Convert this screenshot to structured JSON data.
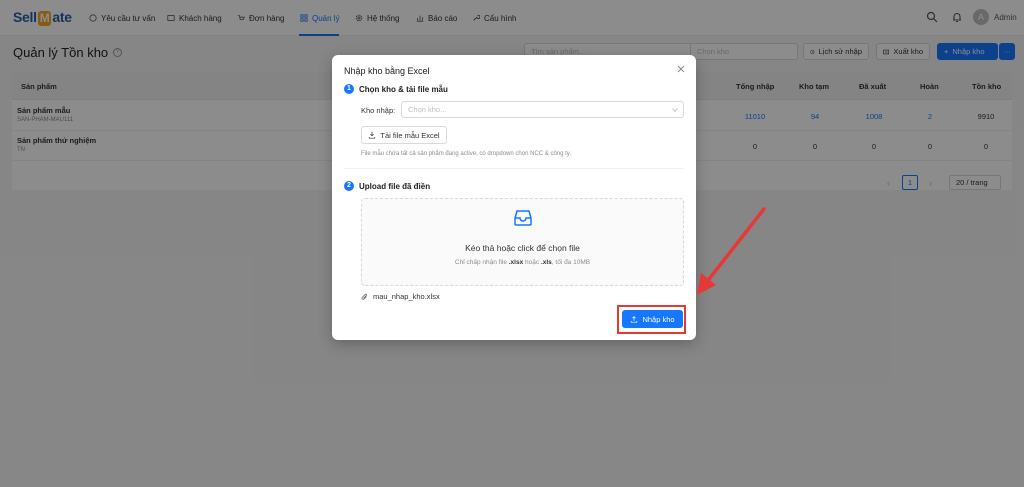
{
  "app": {
    "logo_prefix": "Sell",
    "logo_mark": "M",
    "logo_suffix": "ate",
    "admin_initial": "A",
    "admin_name": "Admin"
  },
  "nav": [
    {
      "label": "Yêu cầu tư vấn",
      "icon": "chat-icon"
    },
    {
      "label": "Khách hàng",
      "icon": "contacts-icon"
    },
    {
      "label": "Đơn hàng",
      "icon": "cart-icon"
    },
    {
      "label": "Quản lý",
      "icon": "grid-icon",
      "active": true
    },
    {
      "label": "Hệ thống",
      "icon": "gear-icon"
    },
    {
      "label": "Báo cáo",
      "icon": "chart-icon"
    },
    {
      "label": "Cấu hình",
      "icon": "wrench-icon"
    }
  ],
  "page": {
    "title": "Quản lý Tồn kho",
    "search_placeholder": "Tìm sản phẩm...",
    "warehouse_placeholder": "Chọn kho",
    "history_btn": "Lịch sử nhập",
    "export_btn": "Xuất kho",
    "import_btn": "Nhập kho"
  },
  "table": {
    "columns": {
      "product": "Sản phẩm",
      "total_in": "Tổng nhập",
      "temp": "Kho tạm",
      "out": "Đã xuất",
      "returned": "Hoàn",
      "stock": "Tồn kho"
    },
    "rows": [
      {
        "name": "Sản phẩm mẫu",
        "sku": "SAN-PHAM-MAU111",
        "total_in": "11010",
        "temp": "94",
        "out": "1008",
        "returned": "2",
        "stock": "9910"
      },
      {
        "name": "Sản phẩm thử nghiệm",
        "sku": "TN",
        "total_in": "0",
        "temp": "0",
        "out": "0",
        "returned": "0",
        "stock": "0"
      }
    ],
    "page": "1",
    "page_size": "20 / trang"
  },
  "modal": {
    "title": "Nhập kho bằng Excel",
    "step1_num": "1",
    "step1_title": "Chọn kho & tải file mẫu",
    "warehouse_label": "Kho nhập:",
    "warehouse_placeholder": "Chọn kho...",
    "template_btn": "Tải file mẫu Excel",
    "template_hint": "File mẫu chứa tất cả sản phẩm đang active, có dropdown chọn NCC & công ty.",
    "step2_num": "2",
    "step2_title": "Upload file đã điền",
    "drop_main": "Kéo thả hoặc click để chọn file",
    "drop_sub_prefix": "Chỉ chấp nhận file ",
    "drop_sub_ext1": ".xlsx",
    "drop_sub_mid": " hoặc ",
    "drop_sub_ext2": ".xls",
    "drop_sub_suffix": ", tối đa 10MB",
    "file_name": "mau_nhap_kho.xlsx",
    "submit_btn": "Nhập kho"
  },
  "colors": {
    "accent": "#1677ff",
    "highlight": "#e53935",
    "logo_blue": "#2b5ea8",
    "logo_orange": "#f5a623"
  }
}
